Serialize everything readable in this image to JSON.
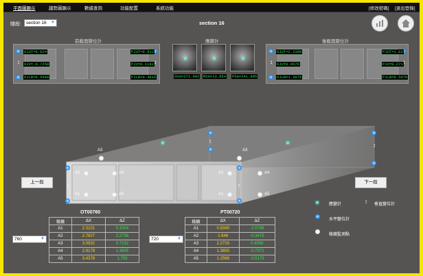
{
  "menu": {
    "items": [
      "平面圖顯示",
      "趨勢圖顯示",
      "數據查詢",
      "功能配置",
      "系統功能"
    ],
    "right": [
      "[修改密碼]",
      "[退出登錄]"
    ]
  },
  "header": {
    "section_label": "隧段:",
    "section_select": "section 16",
    "title": "section 16"
  },
  "panels": {
    "front_title": "前截面變位計",
    "rear_title": "後截面變位計",
    "crack_title": "應變計",
    "front": {
      "ojut": "OJUT=0.624",
      "ojv": "OJV=-0.7258",
      "ojlb": "OJLB=0.5488",
      "pjut": "PJUT=0.912",
      "pjv": "PJV=0.1142",
      "pjlb": "PJLB=0.4816"
    },
    "rear": {
      "ojut": "OJUT=2.2308",
      "ojv": "OJV=0.0576",
      "ojlb": "OJLB=1.3876",
      "pjut": "PJUT=1.03",
      "pjv": "PJV=0.271",
      "pjlb": "PJLB=0.5476"
    },
    "crack": [
      "OSG=373.992",
      "MSG=13.854",
      "PSG=241.905"
    ]
  },
  "tunnel": {
    "front_points": [
      "A1",
      "A2",
      "A3",
      "A4",
      "A5"
    ],
    "rear_points": [
      "A1",
      "A2",
      "A3",
      "A4",
      "A5"
    ]
  },
  "nav": {
    "prev": "上一段",
    "next": "下一段"
  },
  "legend": {
    "strain": "應變計",
    "vertical": "垂直變位計",
    "horizontal": "水平變位計",
    "prism": "稜鏡監測點"
  },
  "tables": {
    "left": {
      "title": "OT00760",
      "select": "760",
      "headers": [
        "稜鏡",
        "ΔX",
        "ΔZ"
      ],
      "rows": [
        [
          "A1",
          "2.3101",
          "0.1904"
        ],
        [
          "A2",
          "2.7827",
          "2.2738"
        ],
        [
          "A3",
          "3.0932",
          "0.7152"
        ],
        [
          "A4",
          "2.9179",
          "1.3805"
        ],
        [
          "A5",
          "3.4378",
          "1.755"
        ]
      ]
    },
    "right": {
      "title": "PT00720",
      "select": "720",
      "headers": [
        "稜鏡",
        "ΔX",
        "ΔZ"
      ],
      "rows": [
        [
          "A1",
          "0.8349",
          "-2.5788"
        ],
        [
          "A2",
          "1.648",
          "-0.3475"
        ],
        [
          "A3",
          "2.2716",
          "0.4056"
        ],
        [
          "A4",
          "1.3855",
          "-0.7371"
        ],
        [
          "A5",
          "1.2566",
          "-0.5173"
        ]
      ]
    }
  },
  "colors": {
    "dx": "#ffd400",
    "dz": "#2ee84a",
    "value_label": "#2ee84a"
  }
}
